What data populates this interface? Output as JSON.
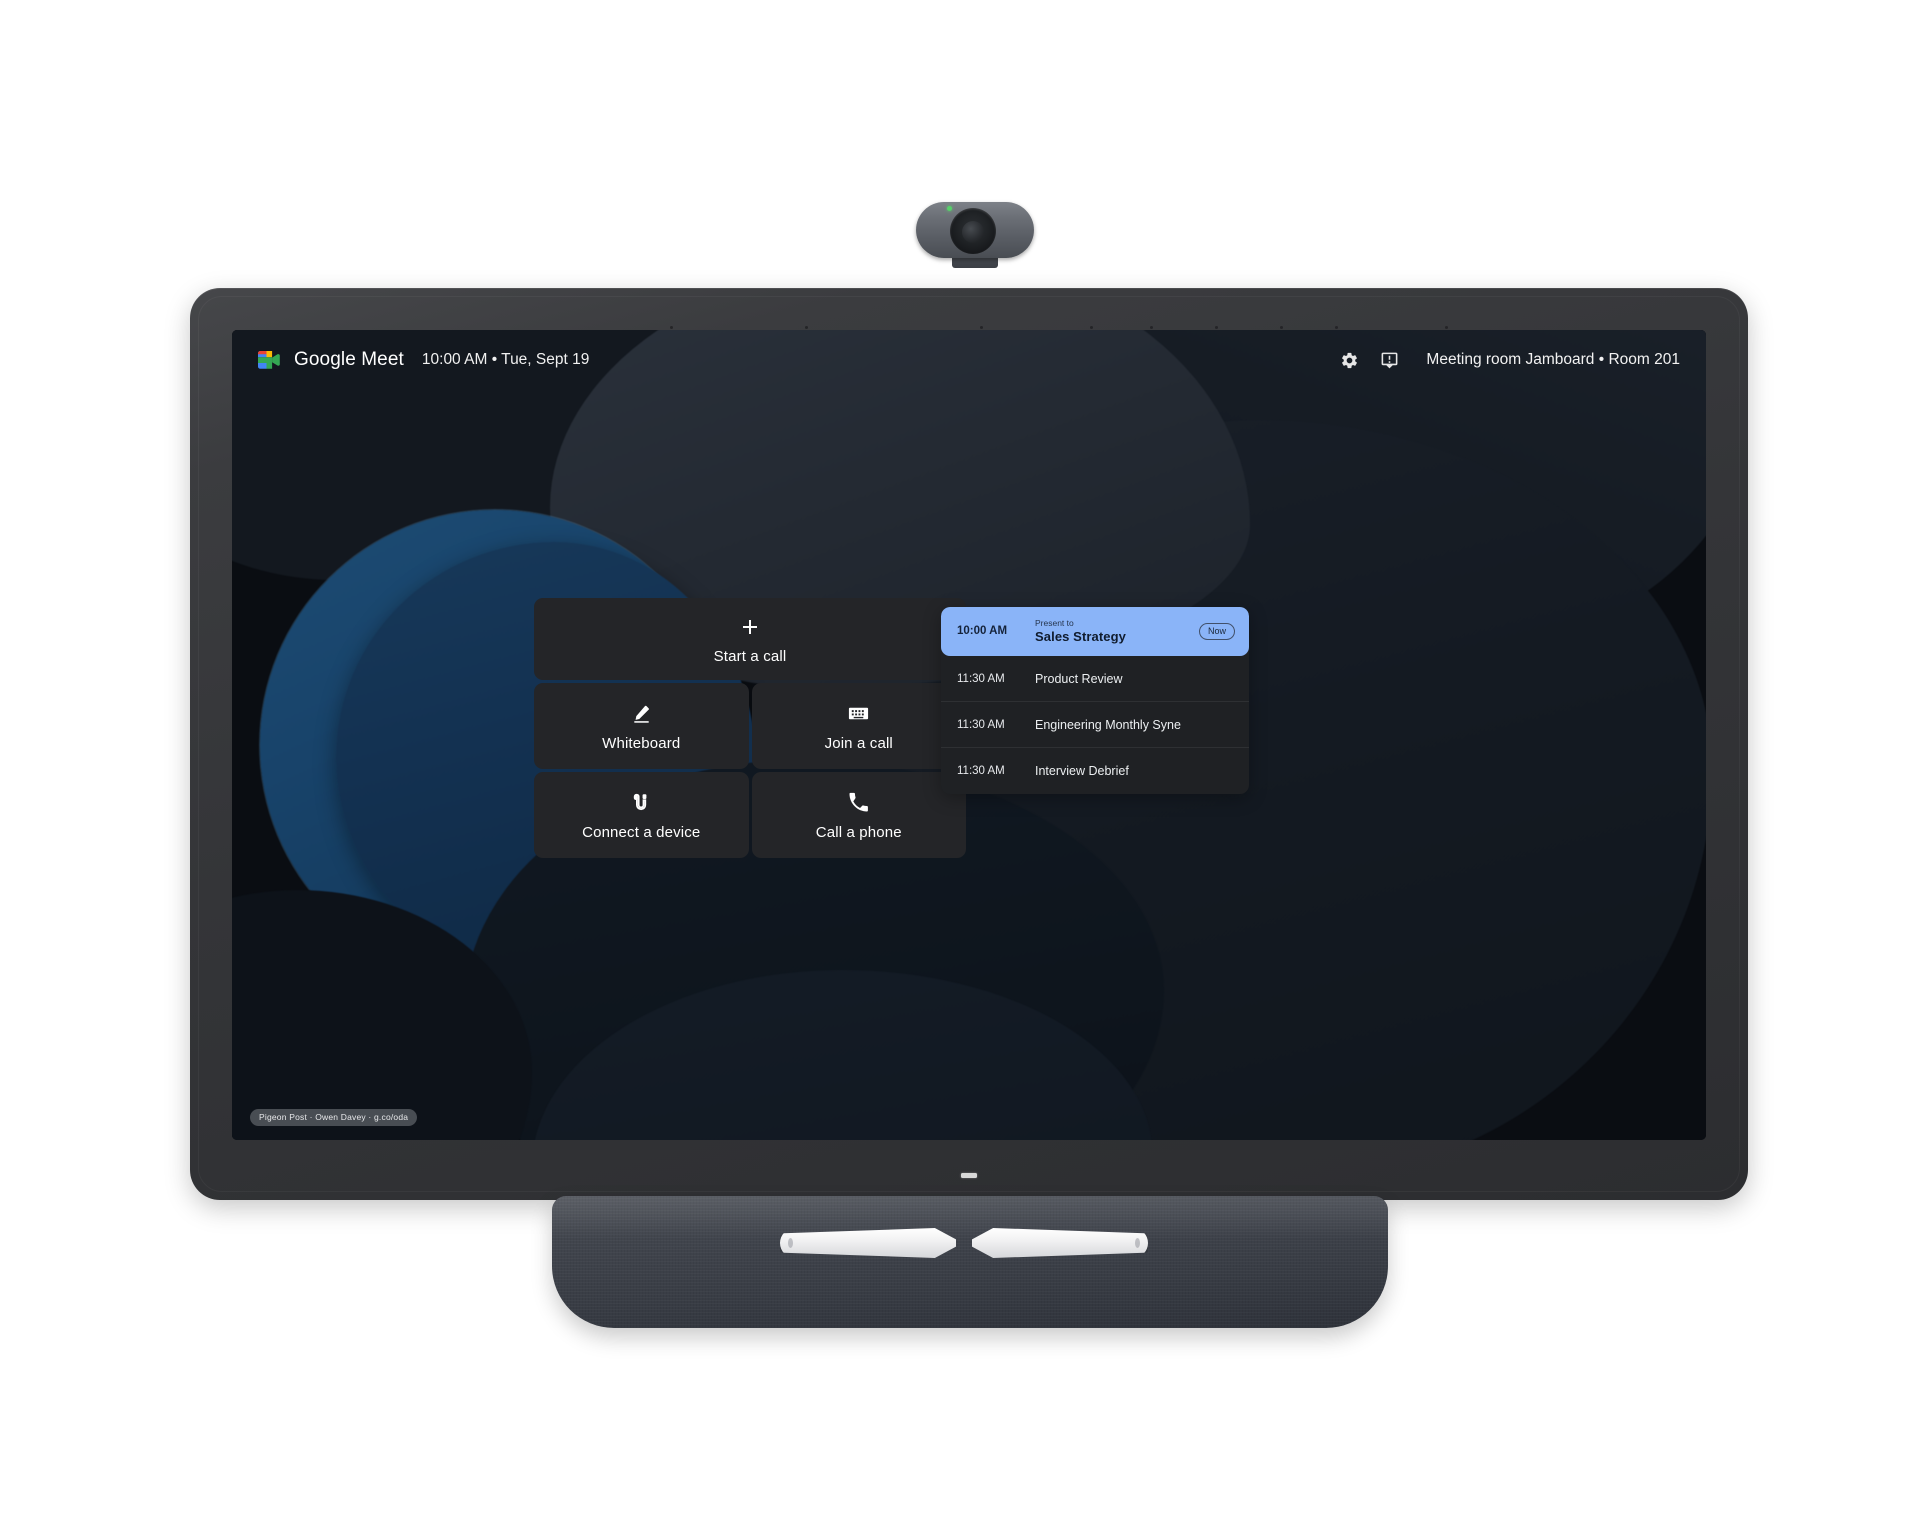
{
  "device": {
    "name": "google-meet-board-65",
    "camera_led_color": "#57d06a",
    "base_style": "fabric"
  },
  "header": {
    "app_name": "Google Meet",
    "time": "10:00 AM",
    "separator": "•",
    "date": "Tue, Sept 19",
    "settings_icon": "gear-icon",
    "feedback_icon": "feedback-icon",
    "room_name": "Meeting room Jamboard",
    "room_separator": "•",
    "room_number": "Room 201"
  },
  "tiles": {
    "start_call": {
      "label": "Start a call",
      "icon": "plus-icon"
    },
    "whiteboard": {
      "label": "Whiteboard",
      "icon": "pen-icon"
    },
    "join_call": {
      "label": "Join a call",
      "icon": "keyboard-icon"
    },
    "connect_device": {
      "label": "Connect a device",
      "icon": "usb-cable-icon"
    },
    "call_phone": {
      "label": "Call a phone",
      "icon": "phone-icon"
    }
  },
  "schedule": {
    "current": {
      "time": "10:00 AM",
      "subtitle": "Present to",
      "title": "Sales Strategy",
      "badge": "Now",
      "highlight_color": "#8ab4f8"
    },
    "upcoming": [
      {
        "time": "11:30 AM",
        "title": "Product Review"
      },
      {
        "time": "11:30 AM",
        "title": "Engineering Monthly Syne"
      },
      {
        "time": "11:30 AM",
        "title": "Interview Debrief"
      }
    ]
  },
  "watermark": {
    "text": "Pigeon Post  ·  Owen Davey  ·  g.co/oda"
  }
}
